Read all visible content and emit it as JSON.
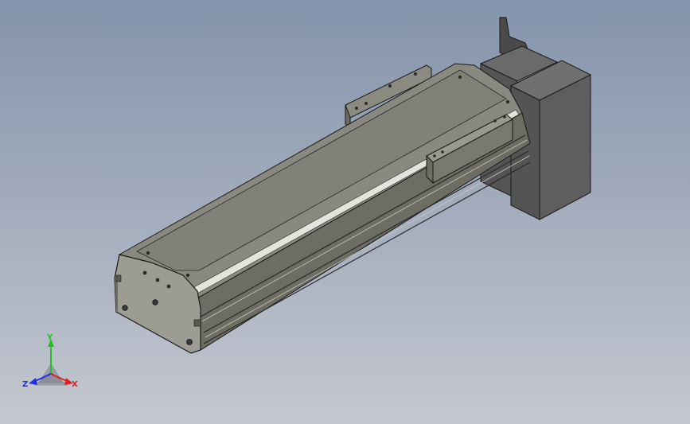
{
  "view": {
    "background_top": "#8494ac",
    "background_bottom": "#c4c8d0"
  },
  "model": {
    "body_color": "#7e7d73",
    "body_top_color": "#8b8a80",
    "end_cap_color": "#9a998f",
    "motor_color": "#5c5c5c",
    "edge_color": "#1a1a1a"
  },
  "triad": {
    "x_label": "X",
    "y_label": "Y",
    "z_label": "Z",
    "x_color": "#e02020",
    "y_color": "#20c020",
    "z_color": "#2030e0"
  }
}
